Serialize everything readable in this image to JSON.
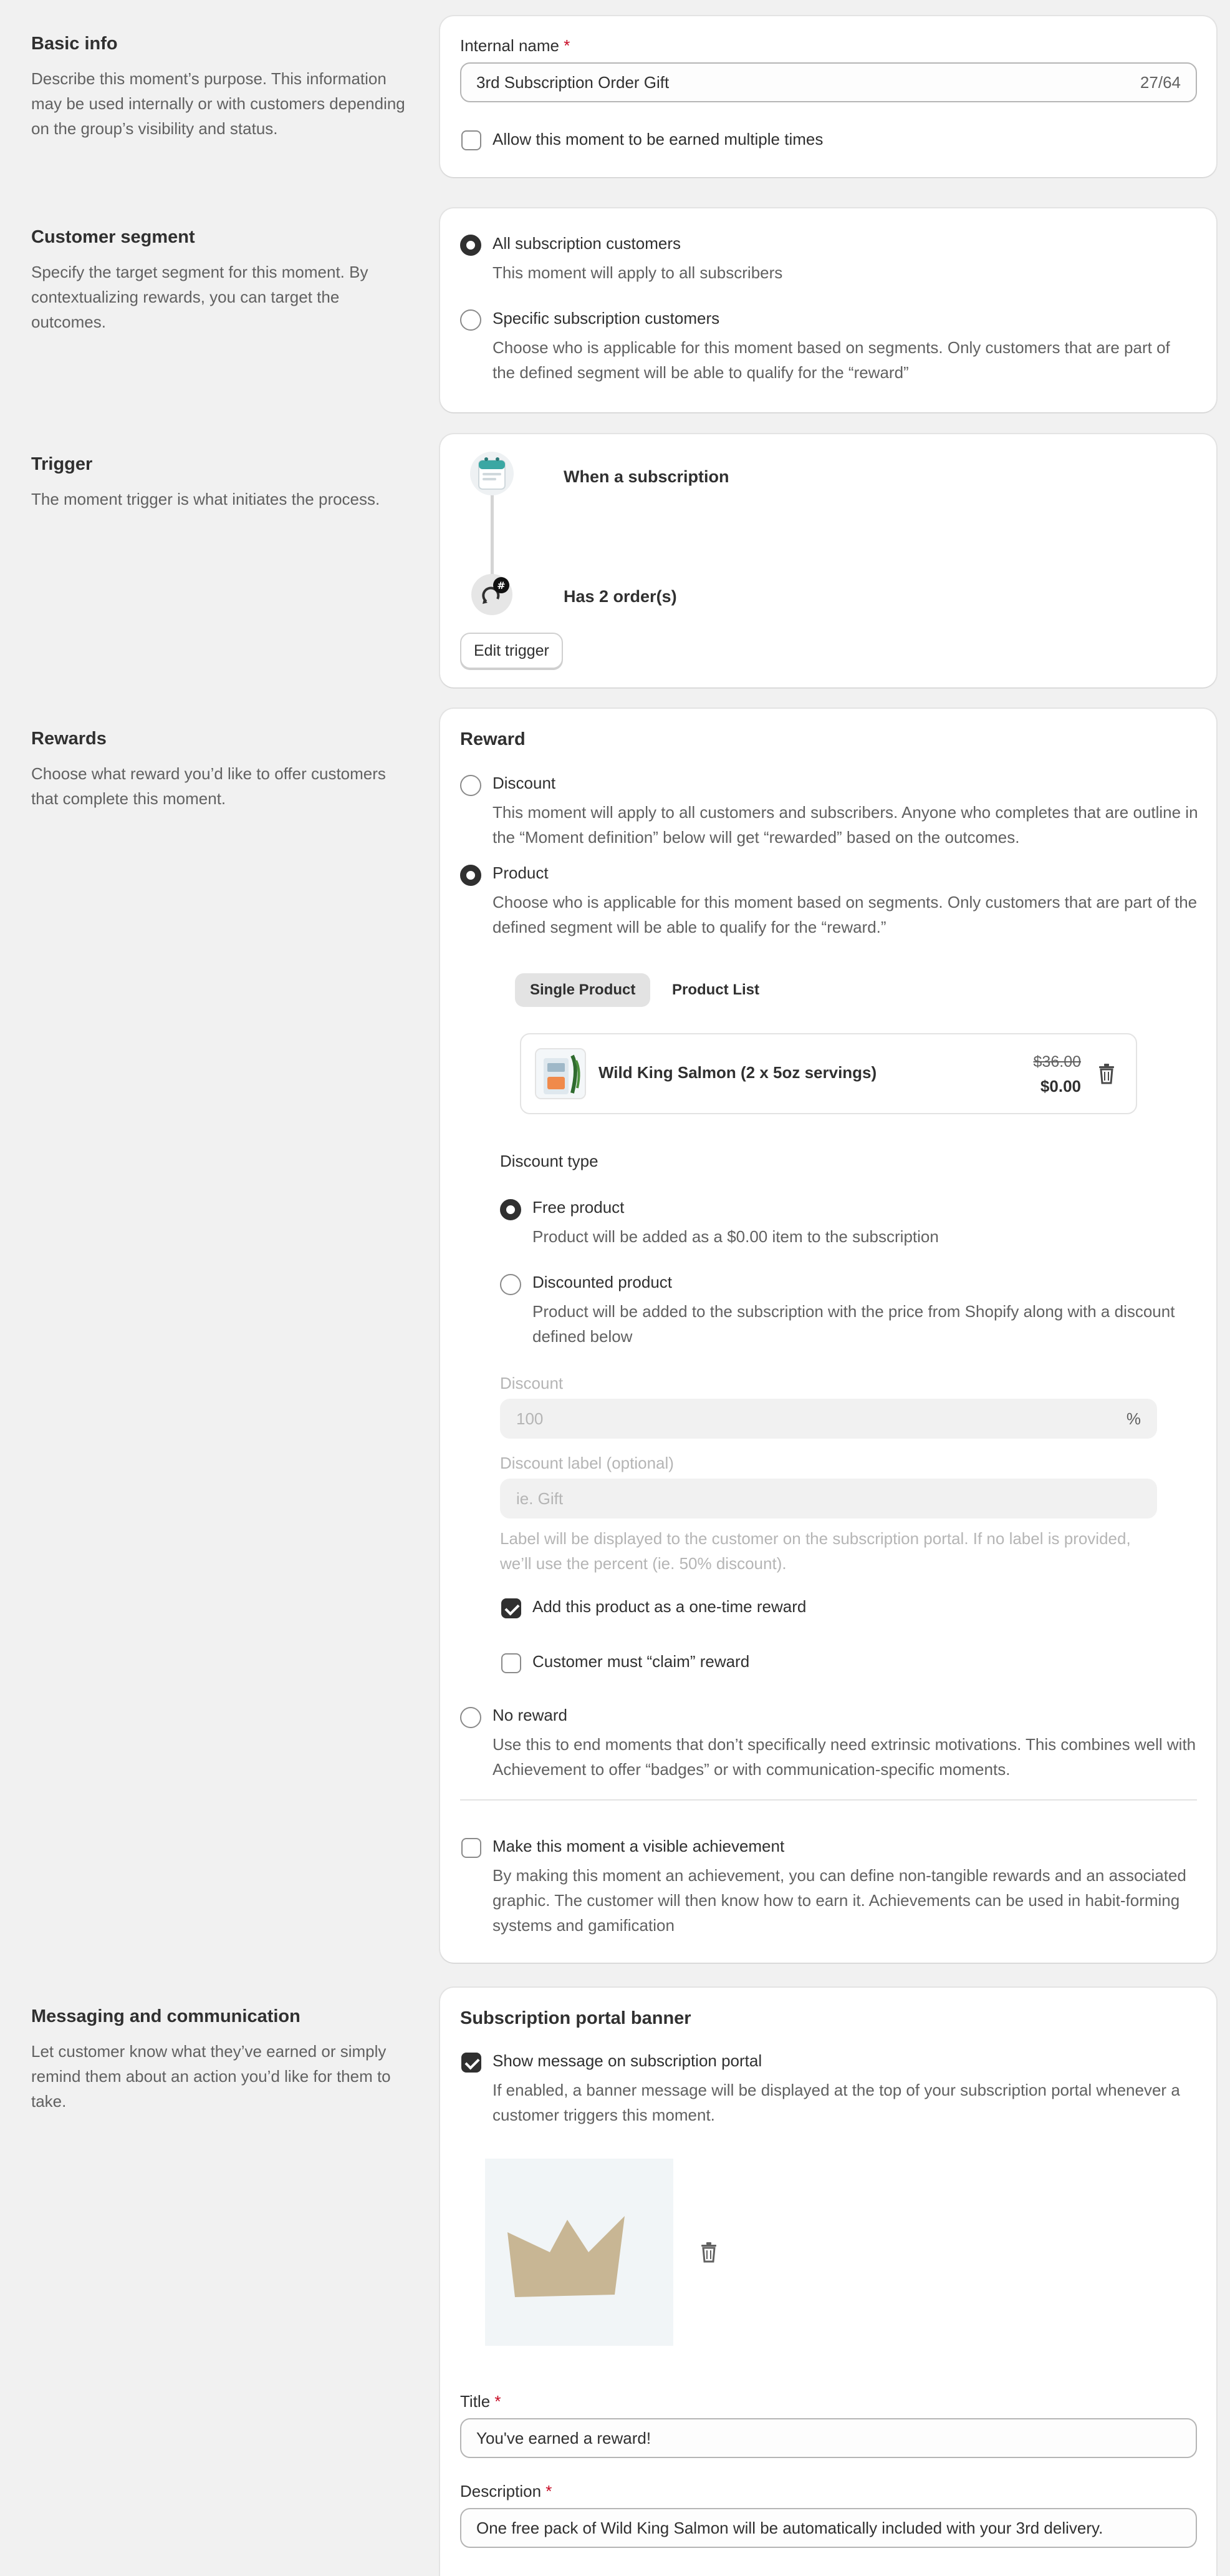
{
  "basic_info": {
    "heading": "Basic info",
    "description": "Describe this moment’s purpose. This information may be used internally or with customers depending on the group’s visibility and status.",
    "internal_name_label": "Internal name",
    "required_mark": "*",
    "internal_name_value": "3rd Subscription Order Gift",
    "char_count": "27/64",
    "multiple_times_label": "Allow this moment to be earned multiple times",
    "multiple_times_checked": false
  },
  "segment": {
    "heading": "Customer segment",
    "description": "Specify the target segment for this moment. By contextualizing rewards, you can target the outcomes.",
    "options": [
      {
        "label": "All subscription customers",
        "help": "This moment will apply to all subscribers",
        "selected": true
      },
      {
        "label": "Specific subscription customers",
        "help": "Choose who is applicable for this moment based on segments. Only customers that are part of the defined segment will be able to qualify for the “reward”",
        "selected": false
      }
    ]
  },
  "trigger": {
    "heading": "Trigger",
    "description": "The moment trigger is what initiates the process.",
    "step1": "When a subscription",
    "step2": "Has 2 order(s)",
    "edit_button": "Edit trigger"
  },
  "rewards": {
    "heading": "Rewards",
    "description": "Choose what reward you’d like to offer customers that complete this moment.",
    "card_title": "Reward",
    "discount_option": {
      "label": "Discount",
      "help": "This moment will apply to all customers and subscribers. Anyone who completes that are outline in the “Moment definition” below will get “rewarded” based on the outcomes.",
      "selected": false
    },
    "product_option": {
      "label": "Product",
      "help": "Choose who is applicable for this moment based on segments. Only customers that are part of the defined segment will be able to qualify for the “reward.”",
      "selected": true
    },
    "tabs": [
      "Single Product",
      "Product List"
    ],
    "product": {
      "name": "Wild King Salmon (2 x 5oz servings)",
      "original_price": "$36.00",
      "price": "$0.00"
    },
    "discount_type_label": "Discount type",
    "free_product": {
      "label": "Free product",
      "help": "Product will be added as a $0.00 item to the subscription",
      "selected": true
    },
    "discounted_product": {
      "label": "Discounted product",
      "help": "Product will be added to the subscription with the price from Shopify along with a discount defined below",
      "selected": false
    },
    "discount_label": "Discount",
    "discount_placeholder": "100",
    "discount_suffix": "%",
    "discount_label_optional": "Discount label (optional)",
    "discount_label_placeholder": "ie. Gift",
    "discount_label_help": "Label will be displayed to the customer on the subscription portal. If no label is provided, we’ll use the percent (ie. 50% discount).",
    "one_time_label": "Add this product as a one-time reward",
    "one_time_checked": true,
    "claim_label": "Customer must “claim” reward",
    "claim_checked": false,
    "no_reward": {
      "label": "No reward",
      "help": "Use this to end moments that don’t specifically need extrinsic motivations. This combines well with Achievement to offer “badges” or with communication-specific moments.",
      "selected": false
    },
    "achievement_label": "Make this moment a visible achievement",
    "achievement_checked": false,
    "achievement_help": "By making this moment an achievement, you can define non-tangible rewards and an associated graphic. The customer will then know how to earn it. Achievements can be used in habit-forming systems and gamification"
  },
  "messaging": {
    "heading": "Messaging and communication",
    "description": "Let customer know what they’ve earned or simply remind them about an action you’d like for them to take.",
    "card_title": "Subscription portal banner",
    "show_message_label": "Show message on subscription portal",
    "show_message_checked": true,
    "show_message_help": "If enabled, a banner message will be displayed at the top of your subscription portal whenever a customer triggers this moment.",
    "title_label": "Title",
    "title_value": "You've earned a reward!",
    "description_label": "Description",
    "description_value": "One free pack of Wild King Salmon will be automatically included with your 3rd delivery."
  },
  "colors": {
    "background": "#f1f1f1",
    "card": "#ffffff",
    "text": "#303030",
    "muted": "#616161",
    "required": "#c70a24",
    "crown": "#c8b694"
  }
}
